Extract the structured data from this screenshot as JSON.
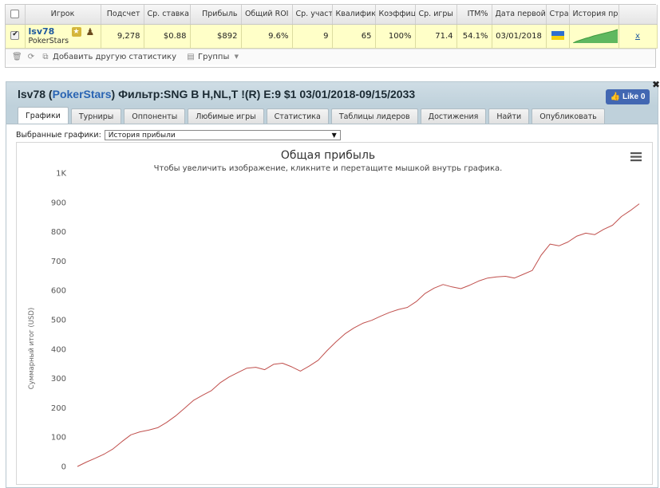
{
  "stats_table": {
    "headers": [
      "",
      "Игрок",
      "Подсчет",
      "Ср. ставка",
      "Прибыль",
      "Общий ROI",
      "Ср. участ",
      "Квалифик",
      "Коэффиц",
      "Ср. игры",
      "ITM%",
      "Дата первой",
      "Стра",
      "История пр",
      ""
    ],
    "row": {
      "checked": true,
      "player_name": "lsv78",
      "room": "PokerStars",
      "count": "9,278",
      "avg_stake": "$0.88",
      "profit": "$892",
      "roi": "9.6%",
      "avg_field": "9",
      "qualified": "65",
      "coefficient": "100%",
      "avg_games": "71.4",
      "itm": "54.1%",
      "first_date": "03/01/2018",
      "country_flag": "ukraine",
      "history_spark": "green-area",
      "remove_label": "x"
    },
    "toolbar": {
      "add_stats_label": "Добавить другую статистику",
      "groups_label": "Группы"
    }
  },
  "panel": {
    "title_player": "lsv78",
    "title_room": "PokerStars",
    "title_filter": "Фильтр:SNG B H,NL,T !(R) E:9 $1 03/01/2018-09/15/2033",
    "like_label": "Like 0",
    "tabs": [
      "Графики",
      "Турниры",
      "Оппоненты",
      "Любимые игры",
      "Статистика",
      "Таблицы лидеров",
      "Достижения",
      "Найти",
      "Опубликовать"
    ],
    "active_tab": 0,
    "selector_label": "Выбранные графики:",
    "selector_value": "История прибыли"
  },
  "chart_data": {
    "type": "line",
    "title": "Общая прибыль",
    "subtitle": "Чтобы увеличить изображение, кликните и перетащите мышкой внутрь графика.",
    "ylabel": "Суммарный итог (USD)",
    "xlabel": "",
    "ylim": [
      0,
      1000
    ],
    "y_ticks": [
      "0",
      "100",
      "200",
      "300",
      "400",
      "500",
      "600",
      "700",
      "800",
      "900",
      "1K"
    ],
    "grid": false,
    "line_color": "#c0504d",
    "series": [
      {
        "values": [
          0,
          15,
          28,
          42,
          60,
          85,
          108,
          118,
          124,
          132,
          150,
          172,
          198,
          225,
          242,
          258,
          285,
          305,
          320,
          335,
          338,
          330,
          348,
          352,
          340,
          325,
          342,
          362,
          395,
          425,
          452,
          472,
          488,
          498,
          512,
          525,
          535,
          542,
          562,
          590,
          608,
          620,
          612,
          606,
          618,
          632,
          642,
          646,
          648,
          642,
          655,
          668,
          720,
          758,
          752,
          765,
          785,
          795,
          790,
          808,
          822,
          852,
          872,
          895
        ]
      }
    ]
  }
}
